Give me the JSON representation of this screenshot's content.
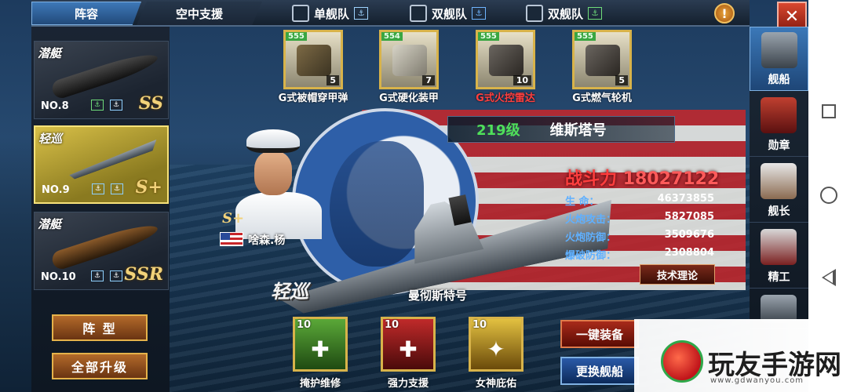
{
  "tabs": {
    "lineup": "阵容",
    "air_support": "空中支援"
  },
  "fleet_options": [
    {
      "label": "单舰队",
      "icon": "single-fleet-icon"
    },
    {
      "label": "双舰队",
      "icon": "double-fleet-icon"
    },
    {
      "label": "双舰队",
      "icon": "double-fleet-alt-icon"
    }
  ],
  "warning": "!",
  "close": "✕",
  "ship_list": [
    {
      "class": "潜艇",
      "no": "NO.8",
      "rank": "SS",
      "type": "submarine"
    },
    {
      "class": "轻巡",
      "no": "NO.9",
      "rank": "S+",
      "type": "cruiser",
      "selected": true
    },
    {
      "class": "潜艇",
      "no": "NO.10",
      "rank": "SSR",
      "type": "submarine"
    }
  ],
  "left_buttons": {
    "formation": "阵 型",
    "upgrade_all": "全部升级"
  },
  "equipment": [
    {
      "level": "555",
      "count": "5",
      "name": "G式被帽穿甲弹",
      "style": "ammo"
    },
    {
      "level": "554",
      "count": "7",
      "name": "G式硬化装甲",
      "style": "armor"
    },
    {
      "level": "555",
      "count": "10",
      "name": "G式火控雷达",
      "style": "radar"
    },
    {
      "level": "555",
      "count": "5",
      "name": "G式燃气轮机",
      "style": "engine"
    }
  ],
  "ship": {
    "level": "219级",
    "name": "维斯塔号",
    "class_label": "轻巡",
    "model_name": "曼彻斯特号"
  },
  "captain": {
    "rank": "S+",
    "name": "啥森.杨"
  },
  "combat": {
    "label": "战斗力",
    "value": "18027122"
  },
  "stats": [
    {
      "key": "生 命：",
      "value": "46373855"
    },
    {
      "key": "火炮攻击：",
      "value": "5827085"
    },
    {
      "key": "火炮防御：",
      "value": "3509676"
    },
    {
      "key": "爆破防御：",
      "value": "2308804"
    }
  ],
  "theory_button": "技术理论",
  "skills": [
    {
      "level": "10",
      "name": "掩护维修",
      "color": "#3f8a2a"
    },
    {
      "level": "10",
      "name": "强力支援",
      "color": "#9a1a1a"
    },
    {
      "level": "10",
      "name": "女神庇佑",
      "color": "#c8a020"
    }
  ],
  "right_buttons": {
    "equip_all": "一键装备",
    "change_ship": "更换舰船"
  },
  "nav": [
    {
      "label": "舰船",
      "icon": "ship-icon",
      "active": true
    },
    {
      "label": "勋章",
      "icon": "medal-icon"
    },
    {
      "label": "舰长",
      "icon": "captain-icon"
    },
    {
      "label": "精工",
      "icon": "refine-icon"
    }
  ],
  "watermark": {
    "text": "玩友手游网",
    "url": "www.gdwanyou.com"
  }
}
